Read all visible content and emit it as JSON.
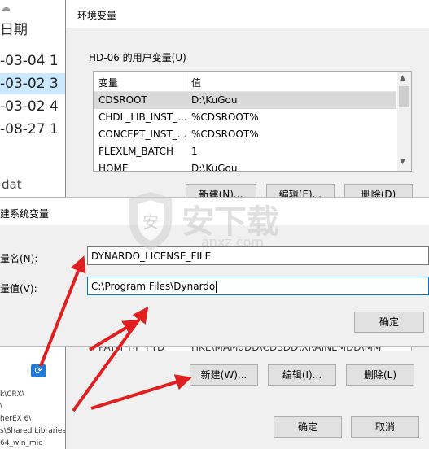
{
  "explorer": {
    "column_header": "日期",
    "rows": [
      {
        "text": "-03-04 1",
        "selected": false
      },
      {
        "text": "-03-02 3",
        "selected": true
      },
      {
        "text": "-03-02 4",
        "selected": false
      },
      {
        "text": "-08-27 1",
        "selected": false
      }
    ],
    "dat_label": "dat",
    "paths": [
      "k\\CRX\\",
      "\\",
      "herEX 6\\",
      "s\\Shared Libraries\\",
      "64_win_mic"
    ]
  },
  "env_window": {
    "title": "环境变量",
    "user_vars_label": "HD-06 的用户变量(U)",
    "columns": [
      "变量",
      "值"
    ],
    "user_vars": [
      {
        "name": "CDSROOT",
        "value": "D:\\KuGou",
        "selected": true
      },
      {
        "name": "CHDL_LIB_INST_...",
        "value": "%CDSROOT%",
        "selected": false
      },
      {
        "name": "CONCEPT_INST_...",
        "value": "%CDSROOT%",
        "selected": false
      },
      {
        "name": "FLEXLM_BATCH",
        "value": "1",
        "selected": false
      },
      {
        "name": "HOME",
        "value": "D:\\KuGou",
        "selected": false
      }
    ],
    "user_buttons": {
      "new": "新建(N)...",
      "edit": "编辑(E)...",
      "delete": "删除(D)"
    },
    "sys_partial_row": {
      "name": "PATH_HF_FTD",
      "value": "HKE\\MAMdDD\\CDSDD\\XRAINEMDD\\MM"
    },
    "sys_buttons": {
      "new": "新建(W)...",
      "edit": "编辑(I)...",
      "delete": "删除(L)"
    },
    "ok": "确定",
    "cancel": "取消"
  },
  "new_var_dialog": {
    "title": "建系统变量",
    "name_label": "量名(N):",
    "value_label": "量值(V):",
    "name_value": "DYNARDO_LICENSE_FILE",
    "value_value": "C:\\Program Files\\Dynardo",
    "ok": "确定"
  },
  "watermark": {
    "text": "安下载",
    "sub": "anxz.com"
  },
  "colors": {
    "arrow": "#e02020",
    "selection": "#cce8ff",
    "focus_border": "#0078d7"
  }
}
